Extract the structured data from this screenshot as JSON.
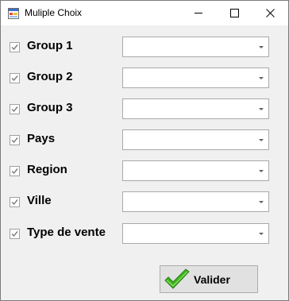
{
  "window": {
    "title": "Muliple Choix",
    "icon": "form-app-icon"
  },
  "controls": {
    "minimize": "minimize-icon",
    "maximize": "maximize-icon",
    "close": "close-icon"
  },
  "rows": [
    {
      "label": "Group 1",
      "checked": true,
      "value": ""
    },
    {
      "label": "Group 2",
      "checked": true,
      "value": ""
    },
    {
      "label": "Group 3",
      "checked": true,
      "value": ""
    },
    {
      "label": "Pays",
      "checked": true,
      "value": ""
    },
    {
      "label": "Region",
      "checked": true,
      "value": ""
    },
    {
      "label": "Ville",
      "checked": true,
      "value": ""
    },
    {
      "label": "Type de vente",
      "checked": true,
      "value": ""
    }
  ],
  "actions": {
    "validate_label": "Valider",
    "validate_icon": "green-checkmark-icon"
  },
  "colors": {
    "form_background": "#f0f0f0",
    "check_color": "#7a7a7a",
    "check_icon_green": "#3fb51f"
  }
}
